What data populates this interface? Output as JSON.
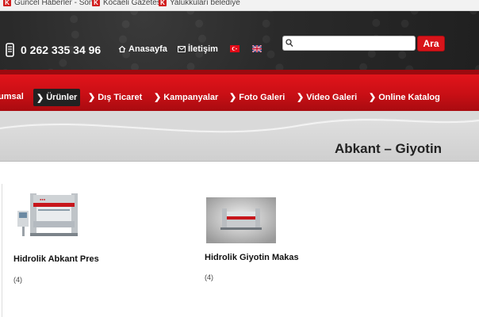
{
  "browser": {
    "bookmarks": [
      {
        "icon": "news-favicon-icon",
        "label": "Güncel Haberler - Son"
      },
      {
        "icon": "news-favicon-icon",
        "label": "Kocaeli Gazetesi"
      },
      {
        "icon": "news-favicon-icon",
        "label": "Yalukkuları belediye"
      }
    ]
  },
  "header": {
    "phone": "0 262 335 34 96",
    "home_label": "Anasayfa",
    "contact_label": "İletişim",
    "search_placeholder": "",
    "search_button": "Ara"
  },
  "nav": {
    "items": [
      {
        "label": "umsal"
      },
      {
        "label": "Ürünler",
        "active": true
      },
      {
        "label": "Dış Ticaret"
      },
      {
        "label": "Kampanyalar"
      },
      {
        "label": "Foto Galeri"
      },
      {
        "label": "Video Galeri"
      },
      {
        "label": "Online Katalog"
      }
    ]
  },
  "page": {
    "title": "Abkant – Giyotin"
  },
  "products": [
    {
      "name": "Hidrolik Abkant Pres",
      "count": "(4)"
    },
    {
      "name": "Hidrolik Giyotin Makas",
      "count": "(4)"
    }
  ],
  "colors": {
    "brand_red": "#d8141a",
    "header_dark": "#2a2a2a",
    "active_nav": "#222222"
  }
}
